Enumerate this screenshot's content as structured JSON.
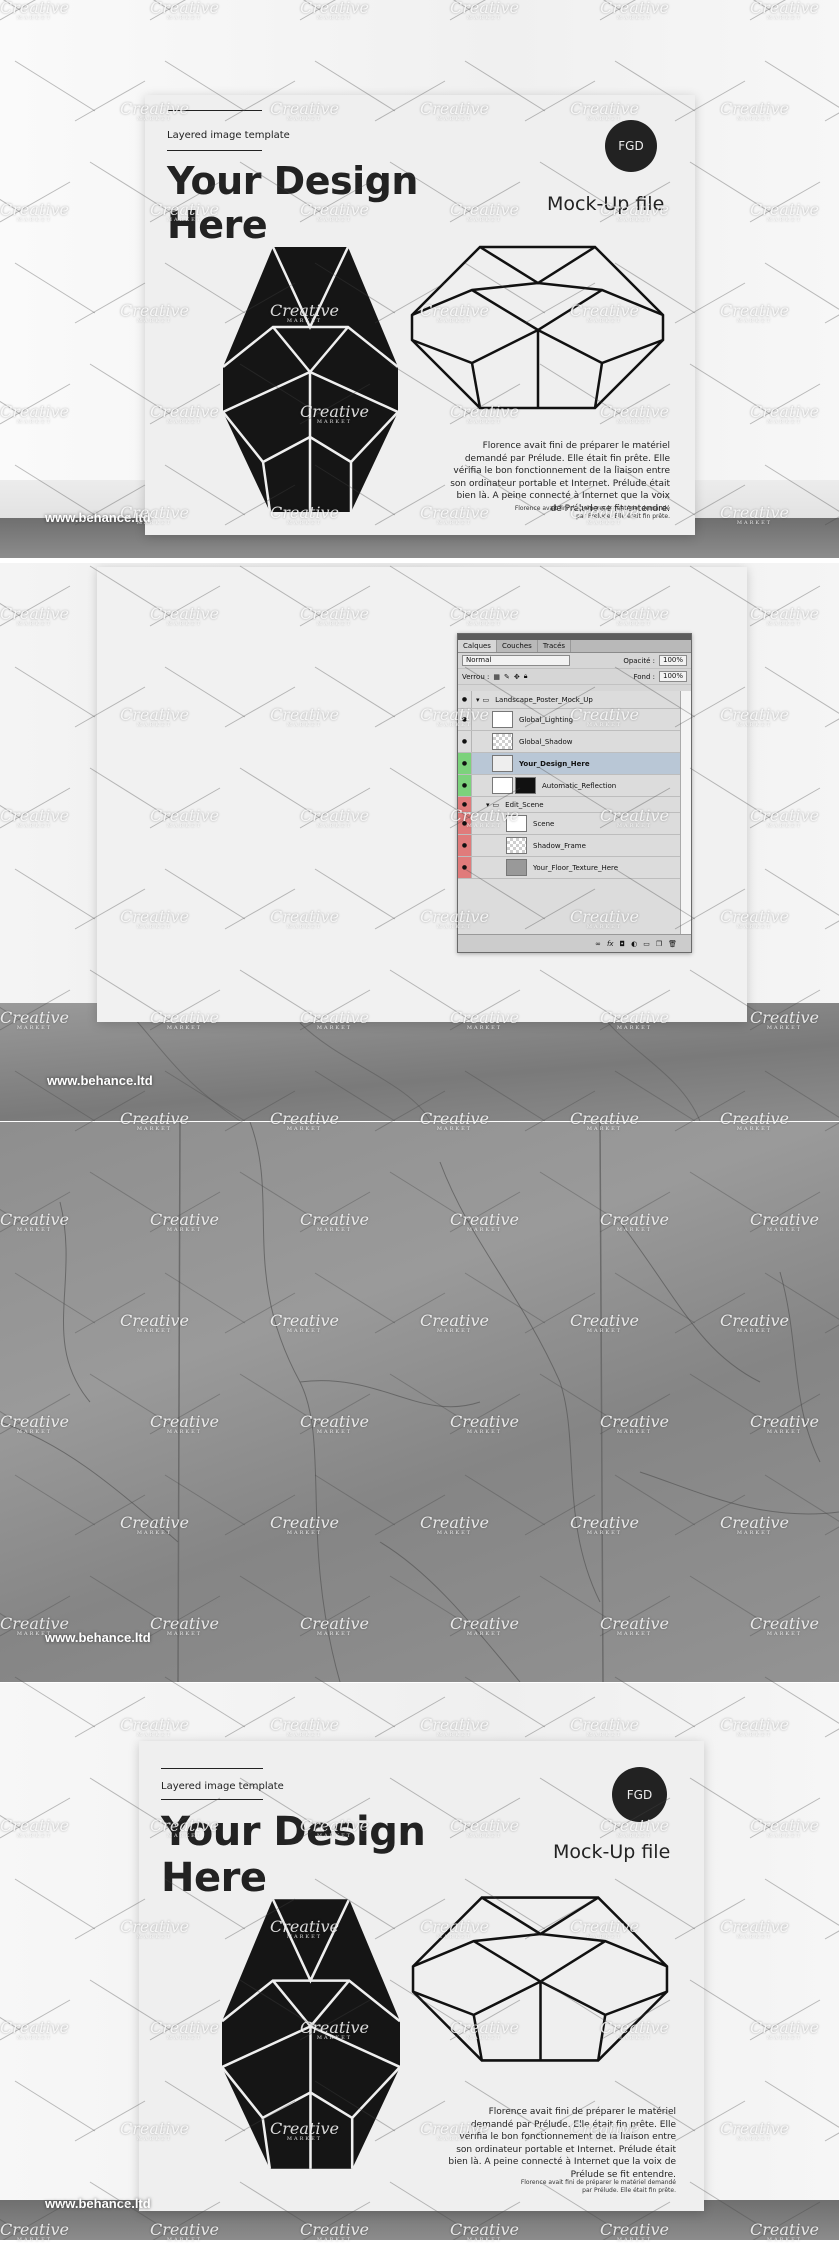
{
  "posters": [
    {
      "label": "Layered image template",
      "title_line1": "Your Design",
      "title_line2": "Here",
      "subtitle": "Mock-Up file",
      "badge": "FGD",
      "body": "Florence avait fini de préparer le matériel demandé par Prélude. Elle était fin prête. Elle vérifia le bon fonctionnement de la liaison entre son ordinateur portable et Internet. Prélude était bien là. A peine connecté à Internet que la voix de Prélude se fit entendre.",
      "fine_print": "Florence avait fini de préparer le matériel demandé par Prélude. Elle était fin prête."
    },
    {
      "label": "Layered image template",
      "title_line1": "Your Design",
      "title_line2": "Here",
      "subtitle": "Mock-Up file",
      "badge": "FGD",
      "body": "Florence avait fini de préparer le matériel demandé par Prélude. Elle était fin prête. Elle vérifia le bon fonctionnement de la liaison entre son ordinateur portable et Internet. Prélude était bien là. A peine connecté à Internet que la voix de Prélude se fit entendre.",
      "fine_print": "Florence avait fini de préparer le matériel demandé par Prélude. Elle était fin prête."
    }
  ],
  "credits": [
    "www.behance.ltd",
    "www.behance.ltd",
    "www.behance.ltd",
    "www.behance.ltd"
  ],
  "watermark": {
    "word": "Creative",
    "sub": "MARKET"
  },
  "photoshop": {
    "tabs": [
      "Calques",
      "Couches",
      "Tracés"
    ],
    "blend_mode": "Normal",
    "opacity_label": "Opacité :",
    "opacity_value": "100%",
    "lock_label": "Verrou :",
    "fill_label": "Fond :",
    "fill_value": "100%",
    "layers": [
      {
        "name": "Landscape_Poster_Mock_Up",
        "kind": "group",
        "indent": 0,
        "tag_color": ""
      },
      {
        "name": "Global_Lighting",
        "kind": "layer",
        "indent": 1,
        "tag_color": ""
      },
      {
        "name": "Global_Shadow",
        "kind": "layer",
        "indent": 1,
        "tag_color": ""
      },
      {
        "name": "Your_Design_Here",
        "kind": "smart",
        "indent": 1,
        "tag_color": "#7cd27c",
        "selected": true
      },
      {
        "name": "Automatic_Reflection",
        "kind": "mask",
        "indent": 2,
        "tag_color": "#7cd27c"
      },
      {
        "name": "Edit_Scene",
        "kind": "group",
        "indent": 1,
        "tag_color": "#e07b7b"
      },
      {
        "name": "Scene",
        "kind": "layer",
        "indent": 2,
        "tag_color": "#e07b7b"
      },
      {
        "name": "Shadow_Frame",
        "kind": "layer",
        "indent": 2,
        "tag_color": "#e07b7b"
      },
      {
        "name": "Your_Floor_Texture_Here",
        "kind": "smart",
        "indent": 2,
        "tag_color": "#e07b7b"
      }
    ],
    "bottom_icons": [
      "link-icon",
      "fx-icon",
      "mask-icon",
      "adjustment-icon",
      "folder-icon",
      "new-layer-icon",
      "trash-icon"
    ]
  },
  "colors": {
    "poster_bg": "#efefef",
    "ink": "#222222",
    "wall": "#f3f3f3",
    "floor": "#7d7d7d",
    "marble": "#8a8a8a"
  }
}
